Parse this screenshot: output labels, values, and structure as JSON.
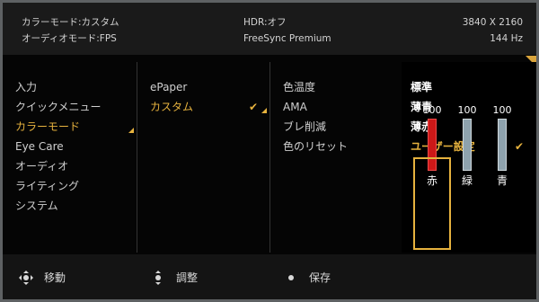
{
  "status": {
    "color_mode": "カラーモード:カスタム",
    "audio_mode": "オーディオモード:FPS",
    "hdr": "HDR:オフ",
    "freesync": "FreeSync Premium",
    "resolution": "3840 X 2160",
    "refresh": "144 Hz"
  },
  "main_menu": {
    "items": [
      "入力",
      "クイックメニュー",
      "カラーモード",
      "Eye Care",
      "オーディオ",
      "ライティング",
      "システム"
    ],
    "selected": "カラーモード"
  },
  "color_modes": {
    "items": [
      "ePaper",
      "カスタム"
    ],
    "selected": "カスタム"
  },
  "custom_settings": {
    "items": [
      "色温度",
      "AMA",
      "ブレ削減",
      "色のリセット"
    ]
  },
  "color_temperature": {
    "items": [
      "標準",
      "薄青",
      "薄赤",
      "ユーザー設定"
    ],
    "selected": "ユーザー設定",
    "sliders": [
      {
        "label": "赤",
        "value": "100",
        "level": 1.0,
        "active": true
      },
      {
        "label": "緑",
        "value": "100",
        "level": 1.0,
        "active": false
      },
      {
        "label": "青",
        "value": "100",
        "level": 1.0,
        "active": false
      }
    ]
  },
  "footer": {
    "move": "移動",
    "adjust": "調整",
    "save": "保存"
  },
  "colors": {
    "accent": "#e6b23e",
    "active_slider": "#d31c1c",
    "inactive_slider": "#a4b4bd",
    "background": "#050505"
  },
  "icons": {
    "joystick": "joystick-icon",
    "check": "check-icon",
    "submenu_marker": "submenu-marker-icon"
  }
}
